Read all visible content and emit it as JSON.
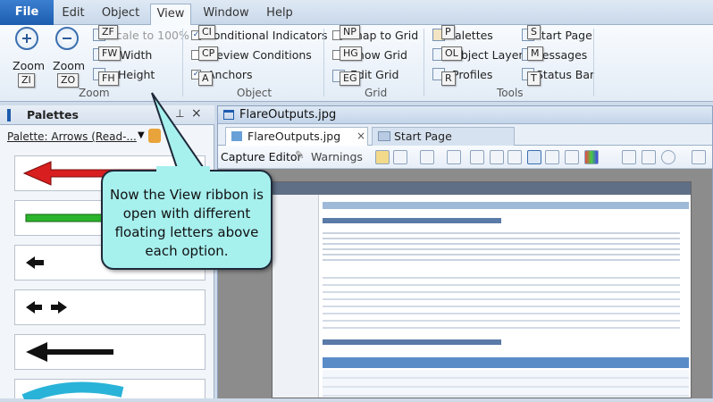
{
  "ribbon_tabs": [
    "File",
    "Edit",
    "Object",
    "View",
    "Window",
    "Help"
  ],
  "active_tab": "View",
  "zoom_group": {
    "label": "Zoom",
    "zoom_in_label": "Zoom",
    "zoom_in_tip": "ZI",
    "zoom_out_label": "Zoom",
    "zoom_out_tip": "ZO",
    "scale_label": "Scale to 100%",
    "scale_tip": "ZF",
    "width_label": "Width",
    "width_tip": "FW",
    "height_label": "Height",
    "height_tip": "FH"
  },
  "object_group": {
    "label": "Object",
    "conditional_label": "Conditional Indicators",
    "conditional_tip": "CI",
    "preview_label": "Preview Conditions",
    "preview_tip": "CP",
    "anchors_label": "Anchors",
    "anchors_tip": "A"
  },
  "grid_group": {
    "label": "Grid",
    "snap_label": "Snap to Grid",
    "snap_tip": "NP",
    "show_label": "Show Grid",
    "show_tip": "HG",
    "edit_label": "Edit Grid",
    "edit_tip": "EG"
  },
  "tools_group": {
    "label": "Tools",
    "palettes_label": "Palettes",
    "palettes_tip": "P",
    "layers_label": "Object Layers",
    "layers_tip": "OL",
    "profiles_label": "Profiles",
    "profiles_tip": "R",
    "startpage_label": "Start Page",
    "startpage_tip": "S",
    "messages_label": "Messages",
    "messages_tip": "M",
    "statusbar_label": "Status Bar",
    "statusbar_tip": "T"
  },
  "palettes_panel": {
    "title": "Palettes",
    "selector": "Palette:  Arrows  (Read-..."
  },
  "document": {
    "window_title": "FlareOutputs.jpg",
    "tabs": [
      "FlareOutputs.jpg",
      "Start Page"
    ],
    "toolbar_capture": "Capture Editor",
    "toolbar_warnings": "Warnings"
  },
  "callout": {
    "text": "Now the View ribbon is open with different floating letters above each option."
  },
  "colors": {
    "file_tab": "#1d5cae",
    "callout_fill": "#a6f0ee",
    "arrow_red": "#d81e1e",
    "arrow_green": "#2cb52c",
    "arrow_cyan": "#29b3d8"
  }
}
